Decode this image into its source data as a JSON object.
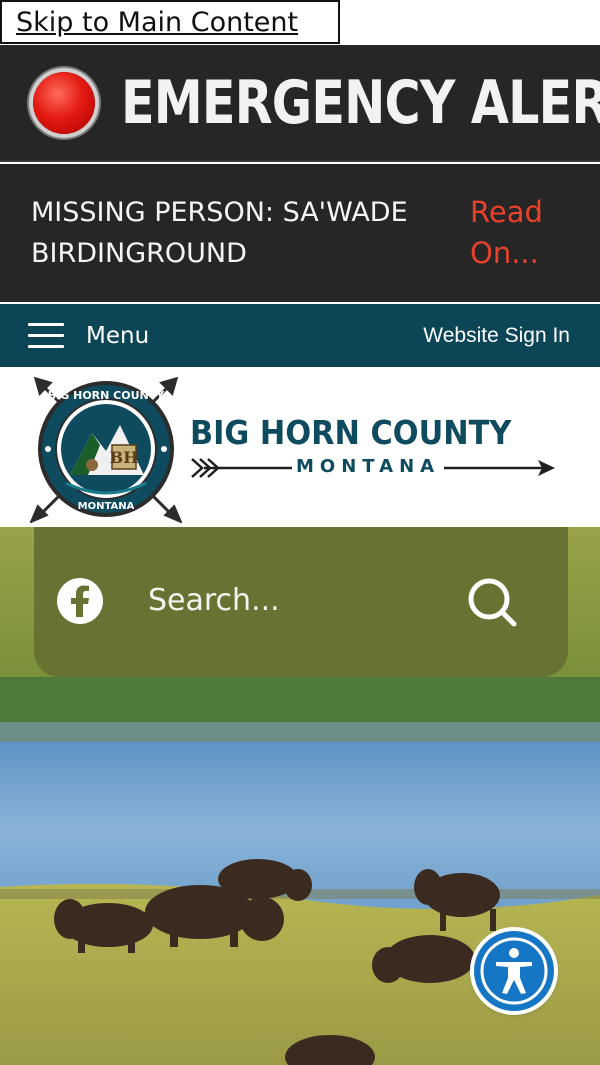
{
  "skip_link": {
    "label": "Skip to Main Content"
  },
  "emergency": {
    "title": "EMERGENCY ALERT",
    "message": "MISSING PERSON: SA'WADE BIRDINGROUND",
    "read_more": "Read On...",
    "colors": {
      "background": "#262626",
      "indicator": "#e41a12",
      "link": "#e8412c"
    }
  },
  "nav": {
    "menu_label": "Menu",
    "menu_icon": "hamburger-icon",
    "sign_in_label": "Website Sign In",
    "background": "#0b4556"
  },
  "logo": {
    "name": "BIG HORN COUNTY",
    "state": "MONTANA",
    "seal_text_top": "BIG HORN COUNTY",
    "seal_text_bottom": "MONTANA",
    "color": "#0f4b5f"
  },
  "search": {
    "placeholder": "Search...",
    "social_icon": "facebook-icon",
    "button_icon": "search-icon",
    "panel_color": "#667333"
  },
  "hero": {
    "image": "bison-by-river-photo"
  },
  "accessibility": {
    "icon": "accessibility-icon",
    "color": "#1576c5"
  }
}
